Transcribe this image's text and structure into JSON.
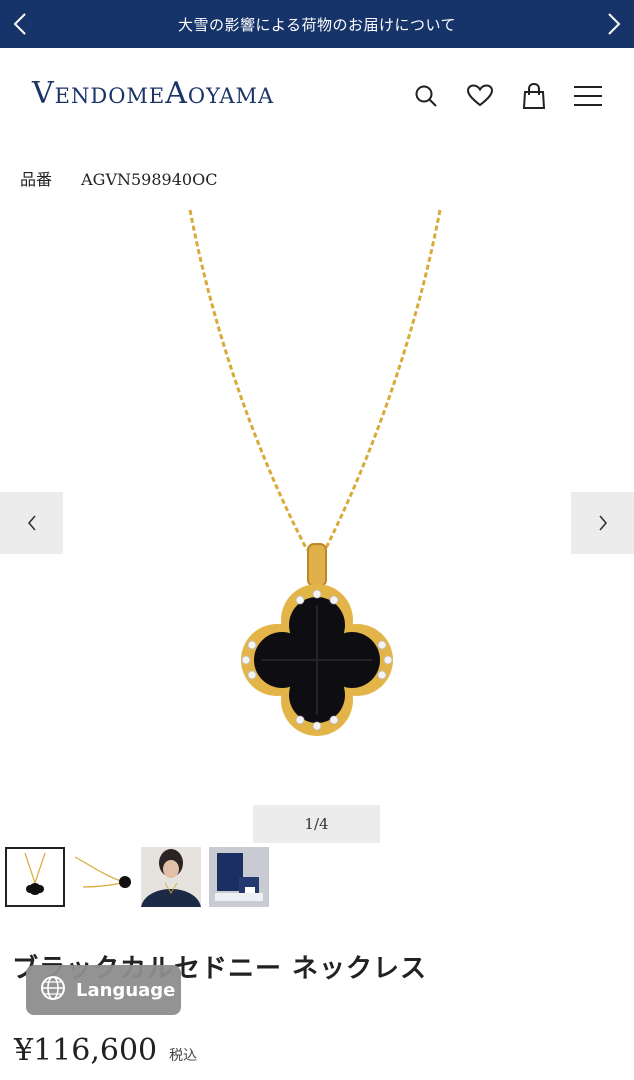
{
  "notice": {
    "text": "大雪の影響による荷物のお届けについて"
  },
  "header": {
    "logo": "VendomeAoyama",
    "icons": [
      "search-icon",
      "heart-icon",
      "bag-icon",
      "menu-icon"
    ]
  },
  "product": {
    "sku_label": "品番",
    "sku": "AGVN598940OC",
    "title": "ブラックカルセドニー ネックレス",
    "price": "¥116,600",
    "tax_label": "税込"
  },
  "gallery": {
    "counter": "1/4",
    "thumbnails": [
      "necklace-front",
      "necklace-side",
      "model-wearing",
      "packaging"
    ]
  },
  "language_button": {
    "label": "Language"
  },
  "colors": {
    "navy": "#17346a",
    "logo": "#1c3368",
    "gold": "#d9a93a"
  }
}
